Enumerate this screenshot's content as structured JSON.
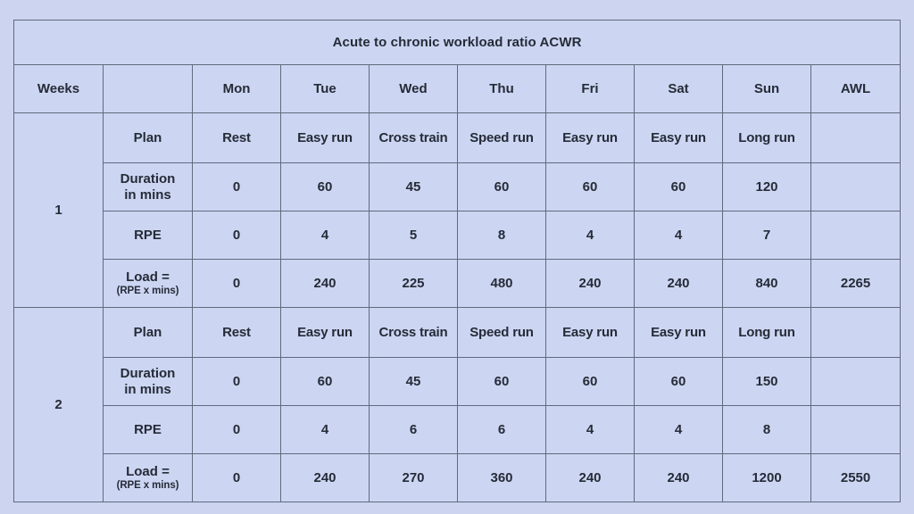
{
  "document": {
    "title": "Acute to chronic workload ratio ACWR",
    "colors": {
      "page_background": "#ccd4f0",
      "cell_background": "#ccd6f2",
      "border": "#606a7d",
      "accent_teal": "#13b0bf",
      "accent_green": "#7caf32",
      "title_background": "#ffffff",
      "text": "#262b38"
    }
  },
  "table": {
    "header": {
      "weeks_label": "Weeks",
      "blank_label": "",
      "days": [
        "Mon",
        "Tue",
        "Wed",
        "Thu",
        "Fri",
        "Sat",
        "Sun"
      ],
      "awl_label": "AWL"
    },
    "row_labels": {
      "plan": "Plan",
      "duration": "Duration in mins",
      "duration_line1": "Duration",
      "duration_line2": "in mins",
      "rpe": "RPE",
      "load_main": "Load =",
      "load_sub": "(RPE x mins)"
    },
    "weeks": [
      {
        "number": "1",
        "plan": [
          "Rest",
          "Easy run",
          "Cross train",
          "Speed run",
          "Easy run",
          "Easy run",
          "Long run"
        ],
        "plan_highlight": [
          true,
          false,
          true,
          false,
          false,
          false,
          false
        ],
        "duration": [
          "0",
          "60",
          "45",
          "60",
          "60",
          "60",
          "120"
        ],
        "rpe": [
          "0",
          "4",
          "5",
          "8",
          "4",
          "4",
          "7"
        ],
        "load": [
          "0",
          "240",
          "225",
          "480",
          "240",
          "240",
          "840"
        ],
        "awl_plan": "",
        "awl_duration": "",
        "awl_rpe": "",
        "awl_load": "2265"
      },
      {
        "number": "2",
        "plan": [
          "Rest",
          "Easy run",
          "Cross train",
          "Speed run",
          "Easy run",
          "Easy run",
          "Long run"
        ],
        "plan_highlight": [
          true,
          false,
          true,
          false,
          false,
          false,
          false
        ],
        "duration": [
          "0",
          "60",
          "45",
          "60",
          "60",
          "60",
          "150"
        ],
        "rpe": [
          "0",
          "4",
          "6",
          "6",
          "4",
          "4",
          "8"
        ],
        "load": [
          "0",
          "240",
          "270",
          "360",
          "240",
          "240",
          "1200"
        ],
        "awl_plan": "",
        "awl_duration": "",
        "awl_rpe": "",
        "awl_load": "2550"
      }
    ]
  }
}
